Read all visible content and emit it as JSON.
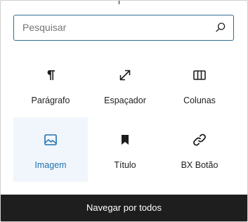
{
  "search": {
    "placeholder": "Pesquisar",
    "value": ""
  },
  "blocks": [
    {
      "label": "Parágrafo",
      "icon": "paragraph-icon",
      "selected": false
    },
    {
      "label": "Espaçador",
      "icon": "resize-arrows-icon",
      "selected": false
    },
    {
      "label": "Colunas",
      "icon": "columns-icon",
      "selected": false
    },
    {
      "label": "Imagem",
      "icon": "image-icon",
      "selected": true
    },
    {
      "label": "Título",
      "icon": "bookmark-icon",
      "selected": false
    },
    {
      "label": "BX Botão",
      "icon": "link-icon",
      "selected": false
    }
  ],
  "footer": {
    "label": "Navegar por todos"
  },
  "colors": {
    "accent": "#2271b1",
    "selected_bg": "#f0f6fb",
    "footer_bg": "#1e1e1e",
    "search_border": "#2f6f8f"
  }
}
